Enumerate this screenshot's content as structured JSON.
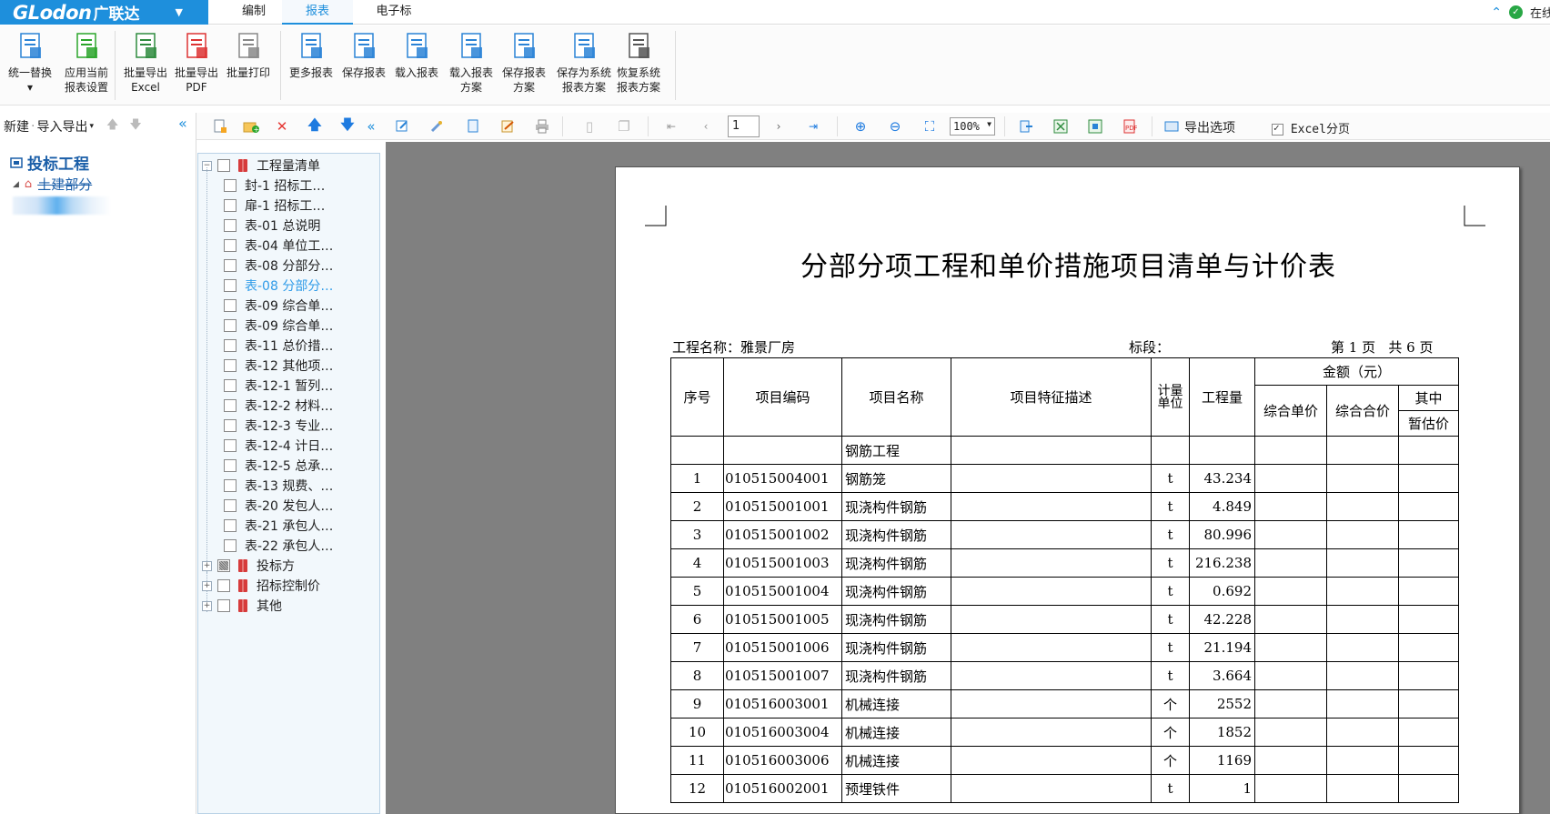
{
  "app": {
    "brand": "GLodon",
    "brand_cn": "广联达",
    "menu_tabs": [
      "编制",
      "报表",
      "电子标"
    ],
    "active_tab": "报表",
    "status_text": "在线"
  },
  "ribbon": {
    "buttons": [
      {
        "icon": "replace-icon",
        "line1": "统一替换",
        "line2": "▾"
      },
      {
        "icon": "apply-settings-icon",
        "line1": "应用当前",
        "line2": "报表设置"
      },
      {
        "icon": "excel-export-icon",
        "line1": "批量导出",
        "line2": "Excel"
      },
      {
        "icon": "pdf-export-icon",
        "line1": "批量导出",
        "line2": "PDF"
      },
      {
        "icon": "batch-print-icon",
        "line1": "批量打印",
        "line2": ""
      },
      {
        "icon": "more-reports-icon",
        "line1": "更多报表",
        "line2": ""
      },
      {
        "icon": "save-report-icon",
        "line1": "保存报表",
        "line2": ""
      },
      {
        "icon": "load-report-icon",
        "line1": "载入报表",
        "line2": ""
      },
      {
        "icon": "load-scheme-icon",
        "line1": "载入报表",
        "line2": "方案"
      },
      {
        "icon": "save-scheme-icon",
        "line1": "保存报表",
        "line2": "方案"
      },
      {
        "icon": "save-system-scheme-icon",
        "line1": "保存为系统",
        "line2": "报表方案"
      },
      {
        "icon": "restore-system-scheme-icon",
        "line1": "恢复系统",
        "line2": "报表方案"
      }
    ]
  },
  "left_panel": {
    "new_label": "新建",
    "import_export_label": "导入导出",
    "project_title": "投标工程",
    "sub_item": "土建部分"
  },
  "toolbar": {
    "page_value": "1",
    "zoom_value": "100%",
    "export_options_label": "导出选项",
    "excel_paging_label": "Excel分页",
    "excel_paging_checked": true
  },
  "tree": {
    "root": "工程量清单",
    "items": [
      "封-1 招标工…",
      "扉-1 招标工…",
      "表-01 总说明",
      "表-04 单位工…",
      "表-08 分部分…",
      "表-08 分部分…",
      "表-09 综合单…",
      "表-09 综合单…",
      "表-11 总价措…",
      "表-12 其他项…",
      "表-12-1 暂列…",
      "表-12-2 材料…",
      "表-12-3 专业…",
      "表-12-4 计日…",
      "表-12-5 总承…",
      "表-13 规费、…",
      "表-20 发包人…",
      "表-21 承包人…",
      "表-22 承包人…"
    ],
    "selected_index": 5,
    "groups": [
      "投标方",
      "招标控制价",
      "其他"
    ]
  },
  "report": {
    "title": "分部分项工程和单价措施项目清单与计价表",
    "project_name": "工程名称：雅景厂房",
    "section": "标段：",
    "page_info": "第 1 页   共 6 页",
    "headers": {
      "seq": "序号",
      "code": "项目编码",
      "name": "项目名称",
      "desc": "项目特征描述",
      "unit": "计量单位",
      "qty": "工程量",
      "amount": "金额（元）",
      "unit_price": "综合单价",
      "total_price": "综合合价",
      "of_which": "其中",
      "provisional": "暂估价"
    },
    "group_row": "钢筋工程",
    "rows": [
      {
        "seq": "1",
        "code": "010515004001",
        "name": "钢筋笼",
        "unit": "t",
        "qty": "43.234"
      },
      {
        "seq": "2",
        "code": "010515001001",
        "name": "现浇构件钢筋",
        "unit": "t",
        "qty": "4.849"
      },
      {
        "seq": "3",
        "code": "010515001002",
        "name": "现浇构件钢筋",
        "unit": "t",
        "qty": "80.996"
      },
      {
        "seq": "4",
        "code": "010515001003",
        "name": "现浇构件钢筋",
        "unit": "t",
        "qty": "216.238"
      },
      {
        "seq": "5",
        "code": "010515001004",
        "name": "现浇构件钢筋",
        "unit": "t",
        "qty": "0.692"
      },
      {
        "seq": "6",
        "code": "010515001005",
        "name": "现浇构件钢筋",
        "unit": "t",
        "qty": "42.228"
      },
      {
        "seq": "7",
        "code": "010515001006",
        "name": "现浇构件钢筋",
        "unit": "t",
        "qty": "21.194"
      },
      {
        "seq": "8",
        "code": "010515001007",
        "name": "现浇构件钢筋",
        "unit": "t",
        "qty": "3.664"
      },
      {
        "seq": "9",
        "code": "010516003001",
        "name": "机械连接",
        "unit": "个",
        "qty": "2552"
      },
      {
        "seq": "10",
        "code": "010516003004",
        "name": "机械连接",
        "unit": "个",
        "qty": "1852"
      },
      {
        "seq": "11",
        "code": "010516003006",
        "name": "机械连接",
        "unit": "个",
        "qty": "1169"
      },
      {
        "seq": "12",
        "code": "010516002001",
        "name": "预埋铁件",
        "unit": "t",
        "qty": "1"
      }
    ]
  }
}
